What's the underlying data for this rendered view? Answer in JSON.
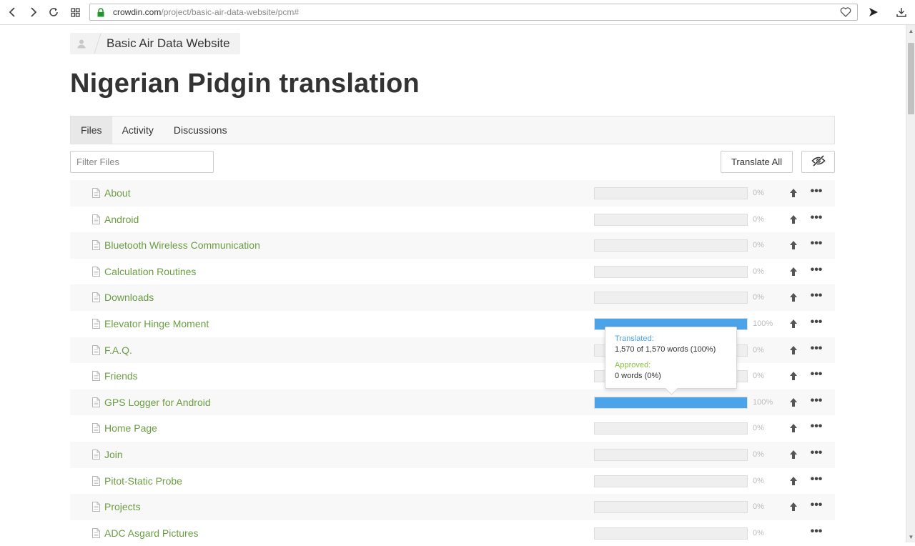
{
  "browser": {
    "url_domain": "crowdin.com",
    "url_path": "/project/basic-air-data-website/pcm#"
  },
  "breadcrumb": {
    "project": "Basic Air Data Website"
  },
  "page": {
    "title": "Nigerian Pidgin translation"
  },
  "tabs": [
    {
      "label": "Files",
      "active": true
    },
    {
      "label": "Activity",
      "active": false
    },
    {
      "label": "Discussions",
      "active": false
    }
  ],
  "toolbar": {
    "filter_placeholder": "Filter Files",
    "translate_all_label": "Translate All"
  },
  "files": [
    {
      "name": "About",
      "percent": "0%",
      "progress": 0,
      "upload": true
    },
    {
      "name": "Android",
      "percent": "0%",
      "progress": 0,
      "upload": true
    },
    {
      "name": "Bluetooth Wireless Communication",
      "percent": "0%",
      "progress": 0,
      "upload": true
    },
    {
      "name": "Calculation Routines",
      "percent": "0%",
      "progress": 0,
      "upload": true
    },
    {
      "name": "Downloads",
      "percent": "0%",
      "progress": 0,
      "upload": true
    },
    {
      "name": "Elevator Hinge Moment",
      "percent": "100%",
      "progress": 1,
      "upload": true
    },
    {
      "name": "F.A.Q.",
      "percent": "0%",
      "progress": 0,
      "upload": true
    },
    {
      "name": "Friends",
      "percent": "0%",
      "progress": 0,
      "upload": true
    },
    {
      "name": "GPS Logger for Android",
      "percent": "100%",
      "progress": 1,
      "upload": true
    },
    {
      "name": "Home Page",
      "percent": "0%",
      "progress": 0,
      "upload": true
    },
    {
      "name": "Join",
      "percent": "0%",
      "progress": 0,
      "upload": true
    },
    {
      "name": "Pitot-Static Probe",
      "percent": "0%",
      "progress": 0,
      "upload": true
    },
    {
      "name": "Projects",
      "percent": "0%",
      "progress": 0,
      "upload": true
    },
    {
      "name": "ADC Asgard Pictures",
      "percent": "0%",
      "progress": 0,
      "upload": false
    }
  ],
  "tooltip": {
    "translated_label": "Translated:",
    "translated_value": "1,570 of 1,570 words (100%)",
    "approved_label": "Approved:",
    "approved_value": "0 words (0%)"
  },
  "colors": {
    "progress_fill": "#4ba3ea",
    "file_link": "#6b9e43",
    "translated_label": "#4ba3ea",
    "approved_label": "#8bbf45"
  }
}
